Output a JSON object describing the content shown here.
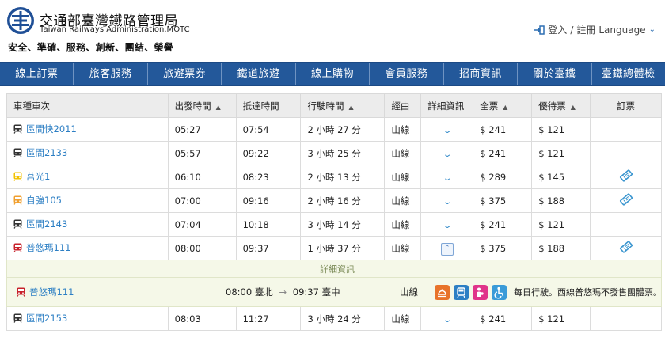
{
  "header": {
    "org_zh": "交通部臺灣鐵路管理局",
    "org_en": "Taiwan Railways Administration.MOTC",
    "slogan": "安全、準確、服務、創新、團結、榮譽",
    "login": "登入",
    "separator": "/",
    "register": "註冊",
    "language": "Language",
    "login_icon": "login-arrow-icon"
  },
  "nav": [
    "線上訂票",
    "旅客服務",
    "旅遊票券",
    "鐵道旅遊",
    "線上購物",
    "會員服務",
    "招商資訊",
    "關於臺鐵",
    "臺鐵總體檢"
  ],
  "table": {
    "columns": [
      "車種車次",
      "出發時間",
      "抵達時間",
      "行駛時間",
      "經由",
      "詳細資訊",
      "全票",
      "優待票",
      "訂票"
    ],
    "rows": [
      {
        "train": "區間快2011",
        "type": "local-express",
        "depart": "05:27",
        "arrive": "07:54",
        "duration": "2 小時 27 分",
        "via": "山線",
        "full": "$ 241",
        "discount": "$ 121",
        "bookable": false,
        "expanded": false
      },
      {
        "train": "區間2133",
        "type": "local",
        "depart": "05:57",
        "arrive": "09:22",
        "duration": "3 小時 25 分",
        "via": "山線",
        "full": "$ 241",
        "discount": "$ 121",
        "bookable": false,
        "expanded": false
      },
      {
        "train": "莒光1",
        "type": "chu-kuang",
        "depart": "06:10",
        "arrive": "08:23",
        "duration": "2 小時 13 分",
        "via": "山線",
        "full": "$ 289",
        "discount": "$ 145",
        "bookable": true,
        "expanded": false
      },
      {
        "train": "自強105",
        "type": "tze-chiang",
        "depart": "07:00",
        "arrive": "09:16",
        "duration": "2 小時 16 分",
        "via": "山線",
        "full": "$ 375",
        "discount": "$ 188",
        "bookable": true,
        "expanded": false
      },
      {
        "train": "區間2143",
        "type": "local",
        "depart": "07:04",
        "arrive": "10:18",
        "duration": "3 小時 14 分",
        "via": "山線",
        "full": "$ 241",
        "discount": "$ 121",
        "bookable": false,
        "expanded": false
      },
      {
        "train": "普悠瑪111",
        "type": "puyuma",
        "depart": "08:00",
        "arrive": "09:37",
        "duration": "1 小時 37 分",
        "via": "山線",
        "full": "$ 375",
        "discount": "$ 188",
        "bookable": true,
        "expanded": true
      }
    ],
    "detail": {
      "heading": "詳細資訊",
      "train": "普悠瑪111",
      "depart_time": "08:00",
      "depart_station": "臺北",
      "arrow": "→",
      "arrive_time": "09:37",
      "arrive_station": "臺中",
      "via": "山線",
      "feature_icons": [
        "dining-car-icon",
        "bicycle-icon",
        "breastfeeding-room-icon",
        "wheelchair-accessible-icon"
      ],
      "note": "每日行駛。西線普悠瑪不發售團體票。"
    },
    "last_row": {
      "train": "區間2153",
      "type": "local",
      "depart": "08:03",
      "arrive": "11:27",
      "duration": "3 小時 24 分",
      "via": "山線",
      "full": "$ 241",
      "discount": "$ 121"
    }
  },
  "colors": {
    "nav_bg": "#23589a",
    "link": "#2d7fc4",
    "local": "#333333",
    "chu-kuang": "#f2c200",
    "tze-chiang": "#f0a030",
    "puyuma": "#c8232c",
    "detail_bg": "#f5f8e8"
  }
}
